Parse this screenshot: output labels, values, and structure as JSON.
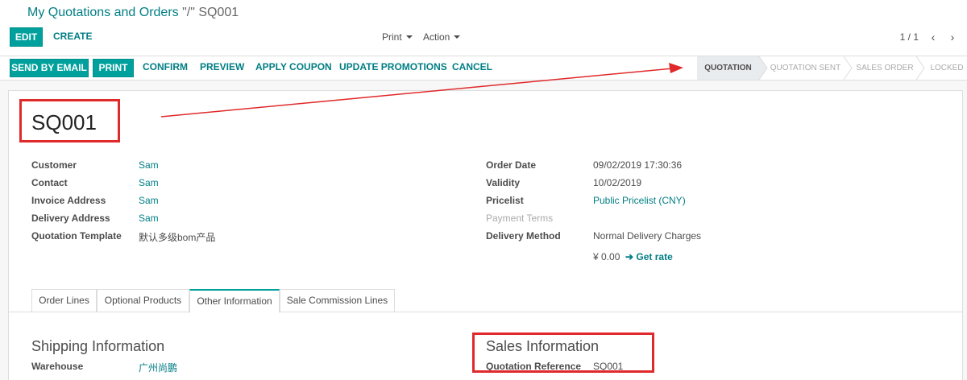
{
  "breadcrumb": {
    "parent": "My Quotations and Orders",
    "sep": "\"/\"",
    "current": "SQ001"
  },
  "toolbar": {
    "edit": "EDIT",
    "create": "CREATE",
    "print": "Print",
    "action": "Action"
  },
  "pager": {
    "value": "1 / 1",
    "prev": "‹",
    "next": "›"
  },
  "statusbar": {
    "buttons": [
      "SEND BY EMAIL",
      "PRINT",
      "CONFIRM",
      "PREVIEW",
      "APPLY COUPON",
      "UPDATE PROMOTIONS",
      "CANCEL"
    ],
    "stages": [
      "QUOTATION",
      "QUOTATION SENT",
      "SALES ORDER",
      "LOCKED"
    ],
    "active_stage": "QUOTATION"
  },
  "record": {
    "name": "SQ001"
  },
  "left_fields": [
    {
      "label": "Customer",
      "value": "Sam"
    },
    {
      "label": "Contact",
      "value": "Sam"
    },
    {
      "label": "Invoice Address",
      "value": "Sam"
    },
    {
      "label": "Delivery Address",
      "value": "Sam"
    },
    {
      "label": "Quotation Template",
      "value": "默认多级bom产品"
    }
  ],
  "right_fields": [
    {
      "label": "Order Date",
      "value": "09/02/2019 17:30:36"
    },
    {
      "label": "Validity",
      "value": "10/02/2019"
    },
    {
      "label": "Pricelist",
      "value": "Public Pricelist (CNY)"
    },
    {
      "label": "Payment Terms",
      "value": ""
    },
    {
      "label": "Delivery Method",
      "value": "Normal Delivery Charges"
    }
  ],
  "delivery": {
    "amount": "¥ 0.00",
    "get_rate": "Get rate"
  },
  "tabs": [
    "Order Lines",
    "Optional Products",
    "Other Information",
    "Sale Commission Lines"
  ],
  "active_tab": "Other Information",
  "shipping": {
    "title": "Shipping Information",
    "warehouse_label": "Warehouse",
    "warehouse_value": "广州尚鹏"
  },
  "sales": {
    "title": "Sales Information",
    "ref_label": "Quotation Reference",
    "ref_value": "SQ001"
  },
  "colors": {
    "accent": "#00a09d",
    "link": "#017e84",
    "annotation": "#e0292a"
  },
  "icons": {
    "pager_prev": "chevron-left-icon",
    "pager_next": "chevron-right-icon",
    "get_rate": "arrow-right-icon"
  }
}
